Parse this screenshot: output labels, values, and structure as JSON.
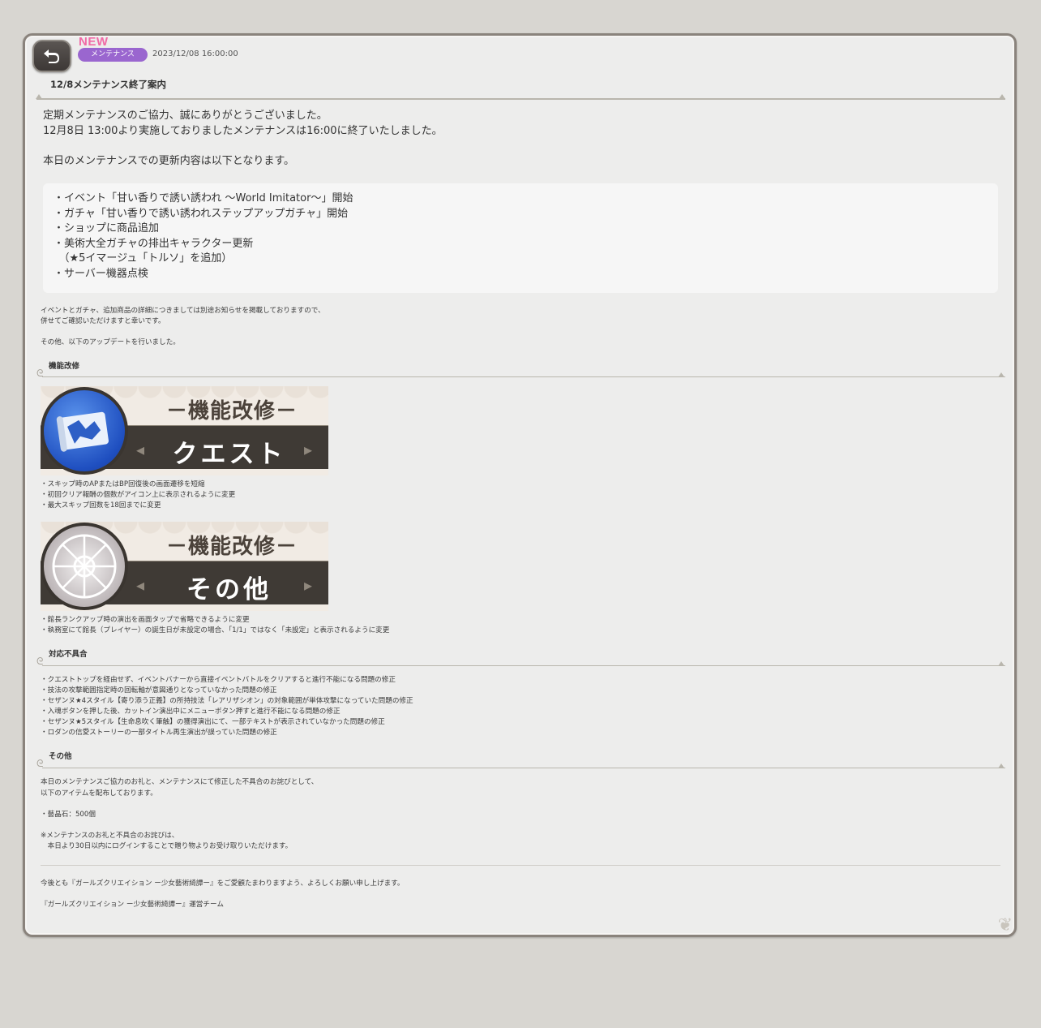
{
  "header": {
    "new_label": "NEW",
    "category": "メンテナンス",
    "date": "2023/12/08 16:00:00",
    "title": "12/8メンテナンス終了案内",
    "back_icon": "return-arrow-icon"
  },
  "intro": [
    "定期メンテナンスのご協力、誠にありがとうございました。",
    "12月8日 13:00より実施しておりましたメンテナンスは16:00に終了いたしました。",
    "本日のメンテナンスでの更新内容は以下となります。"
  ],
  "updates": [
    "・イベント「甘い香りで誘い誘われ 〜World Imitator〜」開始",
    "・ガチャ「甘い香りで誘い誘われステップアップガチャ」開始",
    "・ショップに商品追加",
    "・美術大全ガチャの排出キャラクター更新",
    "　（★5イマージュ「トルソ」を追加）",
    "・サーバー機器点検"
  ],
  "notes": [
    "イベントとガチャ、追加商品の詳細につきましては別途お知らせを掲載しておりますので、",
    "併せてご確認いただけますと幸いです。",
    "その他、以下のアップデートを行いました。"
  ],
  "section_feature": {
    "heading": "機能改修",
    "banner1": {
      "label": "－機能改修－",
      "name": "クエスト",
      "icon": "map-scroll-icon"
    },
    "banner1_items": [
      "・スキップ時のAPまたはBP回復後の画面遷移を短縮",
      "・初回クリア報酬の個数がアイコン上に表示されるように変更",
      "・最大スキップ回数を18回までに変更"
    ],
    "banner2": {
      "label": "－機能改修－",
      "name": "その他",
      "icon": "rose-window-icon"
    },
    "banner2_items": [
      "・館長ランクアップ時の演出を画面タップで省略できるように変更",
      "・執務室にて館長（プレイヤー）の誕生日が未設定の場合、「1/1」ではなく「未設定」と表示されるように変更"
    ]
  },
  "section_bugs": {
    "heading": "対応不具合",
    "items": [
      "・クエストトップを経由せず、イベントバナーから直接イベントバトルをクリアすると進行不能になる問題の修正",
      "・技法の攻撃範囲指定時の回転軸が意図通りとなっていなかった問題の修正",
      "・セザンヌ★4スタイル【寄り添う正義】の所持技法「レアリザシオン」の対象範囲が単体攻撃になっていた問題の修正",
      "・入魂ボタンを押した後、カットイン演出中にメニューボタン押すと進行不能になる問題の修正",
      "・セザンヌ★5スタイル【生命息吹く筆触】の獲得演出にて、一部テキストが表示されていなかった問題の修正",
      "・ロダンの信愛ストーリーの一部タイトル再生演出が誤っていた問題の修正"
    ]
  },
  "section_other": {
    "heading": "その他",
    "lines": [
      "本日のメンテナンスご協力のお礼と、メンテナンスにて修正した不具合のお詫びとして、",
      "以下のアイテムを配布しております。",
      "・藝晶石：500個",
      "※メンテナンスのお礼と不具合のお詫びは、",
      "　本日より30日以内にログインすることで贈り物よりお受け取りいただけます。"
    ]
  },
  "footer": {
    "closing": "今後とも『ガールズクリエイション ー少女藝術綺譚ー』をご愛顧たまわりますよう、よろしくお願い申し上げます。",
    "team": "『ガールズクリエイション ー少女藝術綺譚ー』運営チーム"
  },
  "colors": {
    "background": "#d8d6d1",
    "panel": "#ededec",
    "panel_border": "#8a837c",
    "badge": "#9a66cf",
    "new": "#f16aa6",
    "banner_bar": "#3f3a35"
  }
}
